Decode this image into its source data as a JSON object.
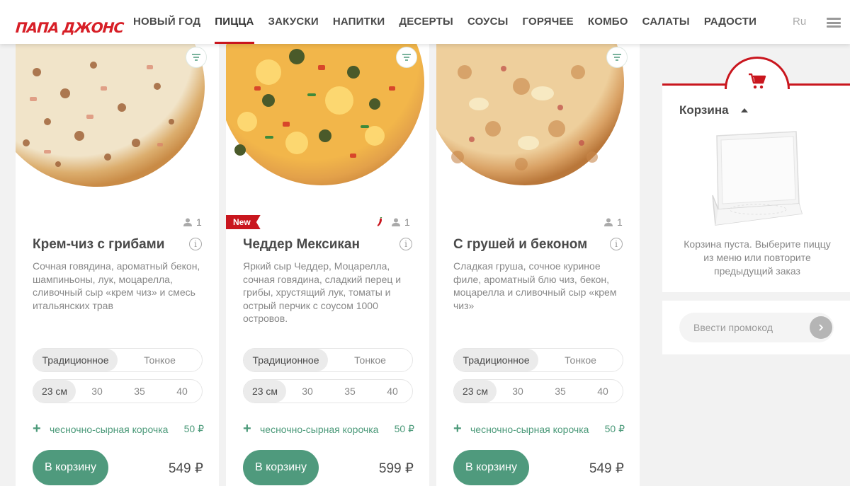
{
  "header": {
    "logo": "ПАПА ДЖОНС",
    "nav": [
      "НОВЫЙ ГОД",
      "ПИЦЦА",
      "ЗАКУСКИ",
      "НАПИТКИ",
      "ДЕСЕРТЫ",
      "СОУСЫ",
      "ГОРЯЧЕЕ",
      "КОМБО",
      "САЛАТЫ",
      "РАДОСТИ"
    ],
    "active_nav": "ПИЦЦА",
    "lang": "Ru",
    "menu_icon": "hamburger-icon"
  },
  "pizzas": [
    {
      "title": "Крем-чиз с грибами",
      "desc": "Сочная говядина, ароматный бекон, шампиньоны, лук, моцарелла, сливочный сыр «крем чиз» и смесь итальянских трав",
      "persons": "1",
      "badge": "",
      "spicy": false,
      "dough": [
        "Традиционное",
        "Тонкое"
      ],
      "sizes": [
        "23 см",
        "30",
        "35",
        "40"
      ],
      "addon_label": "чесночно-сырная корочка",
      "addon_price": "50 ₽",
      "cart_label": "В корзину",
      "price": "549 ₽"
    },
    {
      "title": "Чеддер Мексикан",
      "desc": "Яркий сыр Чеддер, Моцарелла, сочная говядина, сладкий перец и грибы, хрустящий лук, томаты и острый перчик с соусом 1000 островов.",
      "persons": "1",
      "badge": "New",
      "spicy": true,
      "dough": [
        "Традиционное",
        "Тонкое"
      ],
      "sizes": [
        "23 см",
        "30",
        "35",
        "40"
      ],
      "addon_label": "чесночно-сырная корочка",
      "addon_price": "50 ₽",
      "cart_label": "В корзину",
      "price": "599 ₽"
    },
    {
      "title": "С грушей и беконом",
      "desc": "Сладкая груша, сочное куриное филе, ароматный блю чиз, бекон, моцарелла и сливочный сыр «крем чиз»",
      "persons": "1",
      "badge": "",
      "spicy": false,
      "dough": [
        "Традиционное",
        "Тонкое"
      ],
      "sizes": [
        "23 см",
        "30",
        "35",
        "40"
      ],
      "addon_label": "чесночно-сырная корочка",
      "addon_price": "50 ₽",
      "cart_label": "В корзину",
      "price": "549 ₽"
    }
  ],
  "cart": {
    "title": "Корзина",
    "empty_text": "Корзина пуста. Выберите пиццу из меню или повторите предыдущий заказ"
  },
  "promo": {
    "placeholder": "Ввести промокод"
  },
  "colors": {
    "brand_red": "#c9161e",
    "accent_green": "#4f9a7d"
  }
}
